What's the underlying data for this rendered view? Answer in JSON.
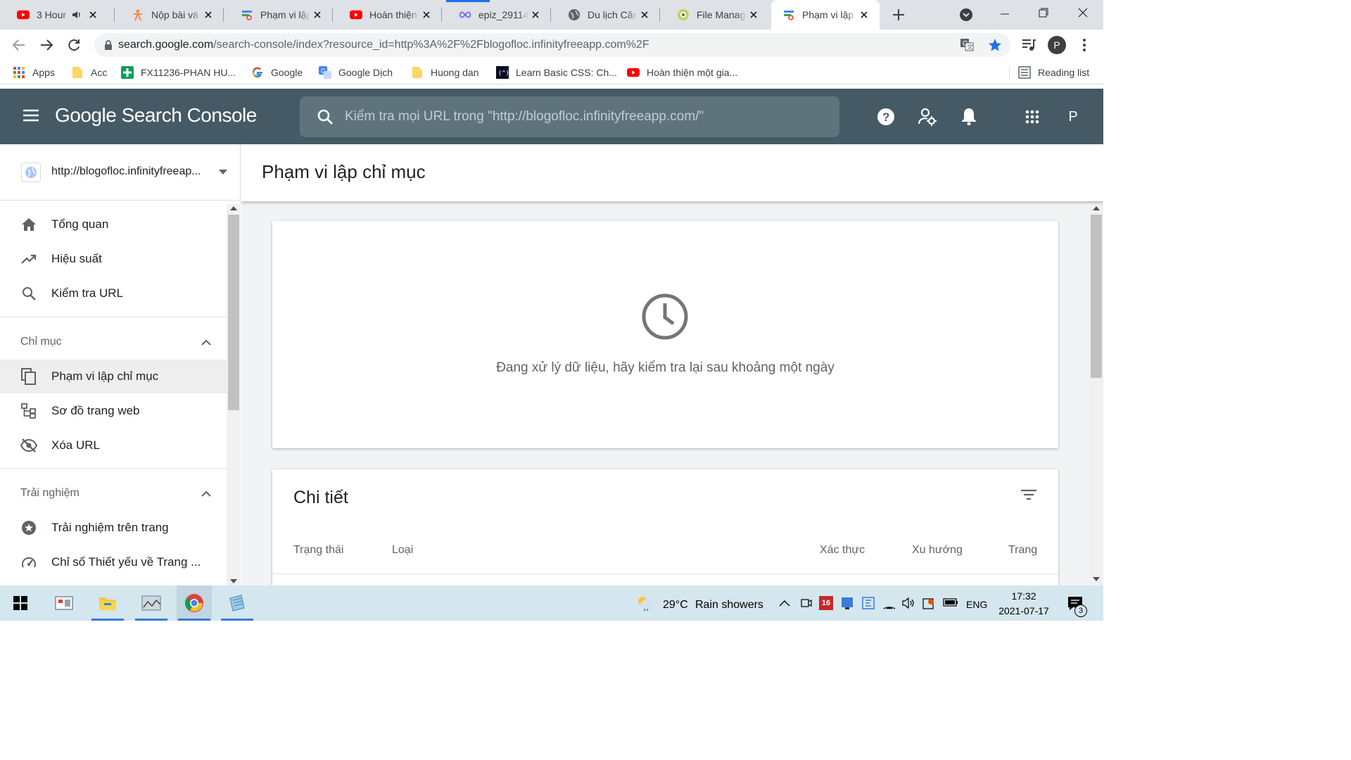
{
  "browser": {
    "tabs": [
      {
        "title": "3 Hour",
        "icon": "youtube-icon"
      },
      {
        "title": "Nộp bài và",
        "icon": "funix-icon"
      },
      {
        "title": "Phạm vi lập",
        "icon": "search-console-icon"
      },
      {
        "title": "Hoàn thiện",
        "icon": "youtube-icon"
      },
      {
        "title": "epiz_29114",
        "icon": "infinity-icon"
      },
      {
        "title": "Du lịch Căn",
        "icon": "globe-icon"
      },
      {
        "title": "File Manage",
        "icon": "file-manager-icon"
      },
      {
        "title": "Phạm vi lập",
        "icon": "search-console-icon",
        "active": true
      }
    ],
    "url_host": "search.google.com",
    "url_path": "/search-console/index?resource_id=http%3A%2F%2Fblogofloc.infinityfreeapp.com%2F",
    "profile_initial": "P",
    "bookmarks": [
      {
        "label": "Apps",
        "icon": "apps-grid-icon"
      },
      {
        "label": "Acc",
        "icon": "folder-icon"
      },
      {
        "label": "FX11236-PHAN HU...",
        "icon": "sheets-icon"
      },
      {
        "label": "Google",
        "icon": "google-icon"
      },
      {
        "label": "Google Dịch",
        "icon": "translate-icon"
      },
      {
        "label": "Huong dan",
        "icon": "folder-icon"
      },
      {
        "label": "Learn Basic CSS: Ch...",
        "icon": "fcc-icon"
      },
      {
        "label": "Hoàn thiện một gia...",
        "icon": "youtube-icon"
      }
    ],
    "reading_list": "Reading list"
  },
  "console": {
    "title_google": "Google",
    "title_rest": "Search Console",
    "search_placeholder": "Kiểm tra mọi URL trong \"http://blogofloc.infinityfreeapp.com/\"",
    "avatar": "P"
  },
  "sidebar": {
    "property": "http://blogofloc.infinityfreeap...",
    "top_items": [
      {
        "label": "Tổng quan",
        "icon": "home-icon"
      },
      {
        "label": "Hiệu suất",
        "icon": "trending-up-icon"
      },
      {
        "label": "Kiểm tra URL",
        "icon": "search-icon"
      }
    ],
    "section_index": "Chỉ mục",
    "index_items": [
      {
        "label": "Phạm vi lập chỉ mục",
        "icon": "coverage-icon",
        "active": true
      },
      {
        "label": "Sơ đồ trang web",
        "icon": "sitemap-icon"
      },
      {
        "label": "Xóa URL",
        "icon": "visibility-off-icon"
      }
    ],
    "section_experience": "Trải nghiệm",
    "experience_items": [
      {
        "label": "Trải nghiệm trên trang",
        "icon": "page-experience-icon"
      },
      {
        "label": "Chỉ số Thiết yếu về Trang ...",
        "icon": "speed-gauge-icon"
      }
    ]
  },
  "main": {
    "page_title": "Phạm vi lập chỉ mục",
    "processing_message": "Đang xử lý dữ liệu, hãy kiểm tra lại sau khoảng một ngày",
    "details_title": "Chi tiết",
    "columns": [
      "Trạng thái",
      "Loại",
      "Xác thực",
      "Xu hướng",
      "Trang"
    ]
  },
  "taskbar": {
    "weather_temp": "29°C",
    "weather_desc": "Rain showers",
    "language": "ENG",
    "time": "17:32",
    "date": "2021-07-17",
    "notification_count": "3",
    "tray_badge": "16"
  },
  "colors": {
    "header_bg": "#455a64",
    "accent_blue": "#1a73e8",
    "tab_strip": "#dee1e6",
    "taskbar_bg": "#d4e6ee"
  }
}
